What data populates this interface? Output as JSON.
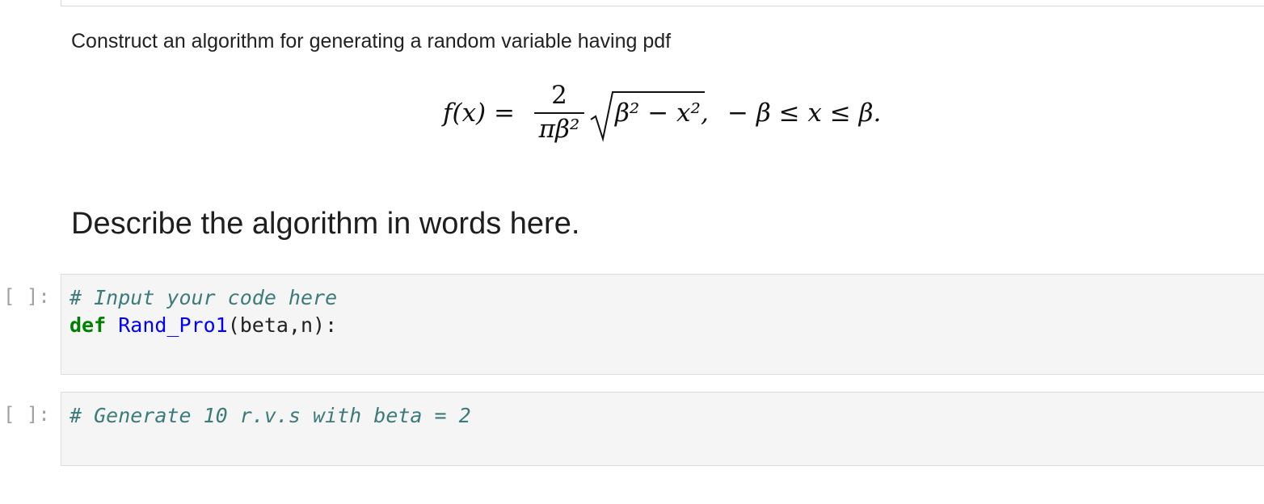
{
  "markdown": {
    "intro_text": "Construct an algorithm for generating a random variable having pdf",
    "heading": "Describe the algorithm in words here."
  },
  "formula": {
    "lhs": "f(x) =",
    "numerator": "2",
    "denominator": "πβ²",
    "radicand": "β² − x²,",
    "domain": "− β ≤ x ≤ β."
  },
  "cells": [
    {
      "prompt": "[ ]:",
      "lines": {
        "comment": "# Input your code here",
        "keyword": "def",
        "function_name": "Rand_Pro1",
        "args": "(beta,n):"
      }
    },
    {
      "prompt": "[ ]:",
      "lines": {
        "comment": "# Generate 10 r.v.s with beta = 2"
      }
    }
  ],
  "colors": {
    "comment": "#3d7b7b",
    "keyword": "#008000",
    "function_name": "#0000ff",
    "cell_background": "#f5f5f5",
    "prompt": "#a0a0a0"
  }
}
